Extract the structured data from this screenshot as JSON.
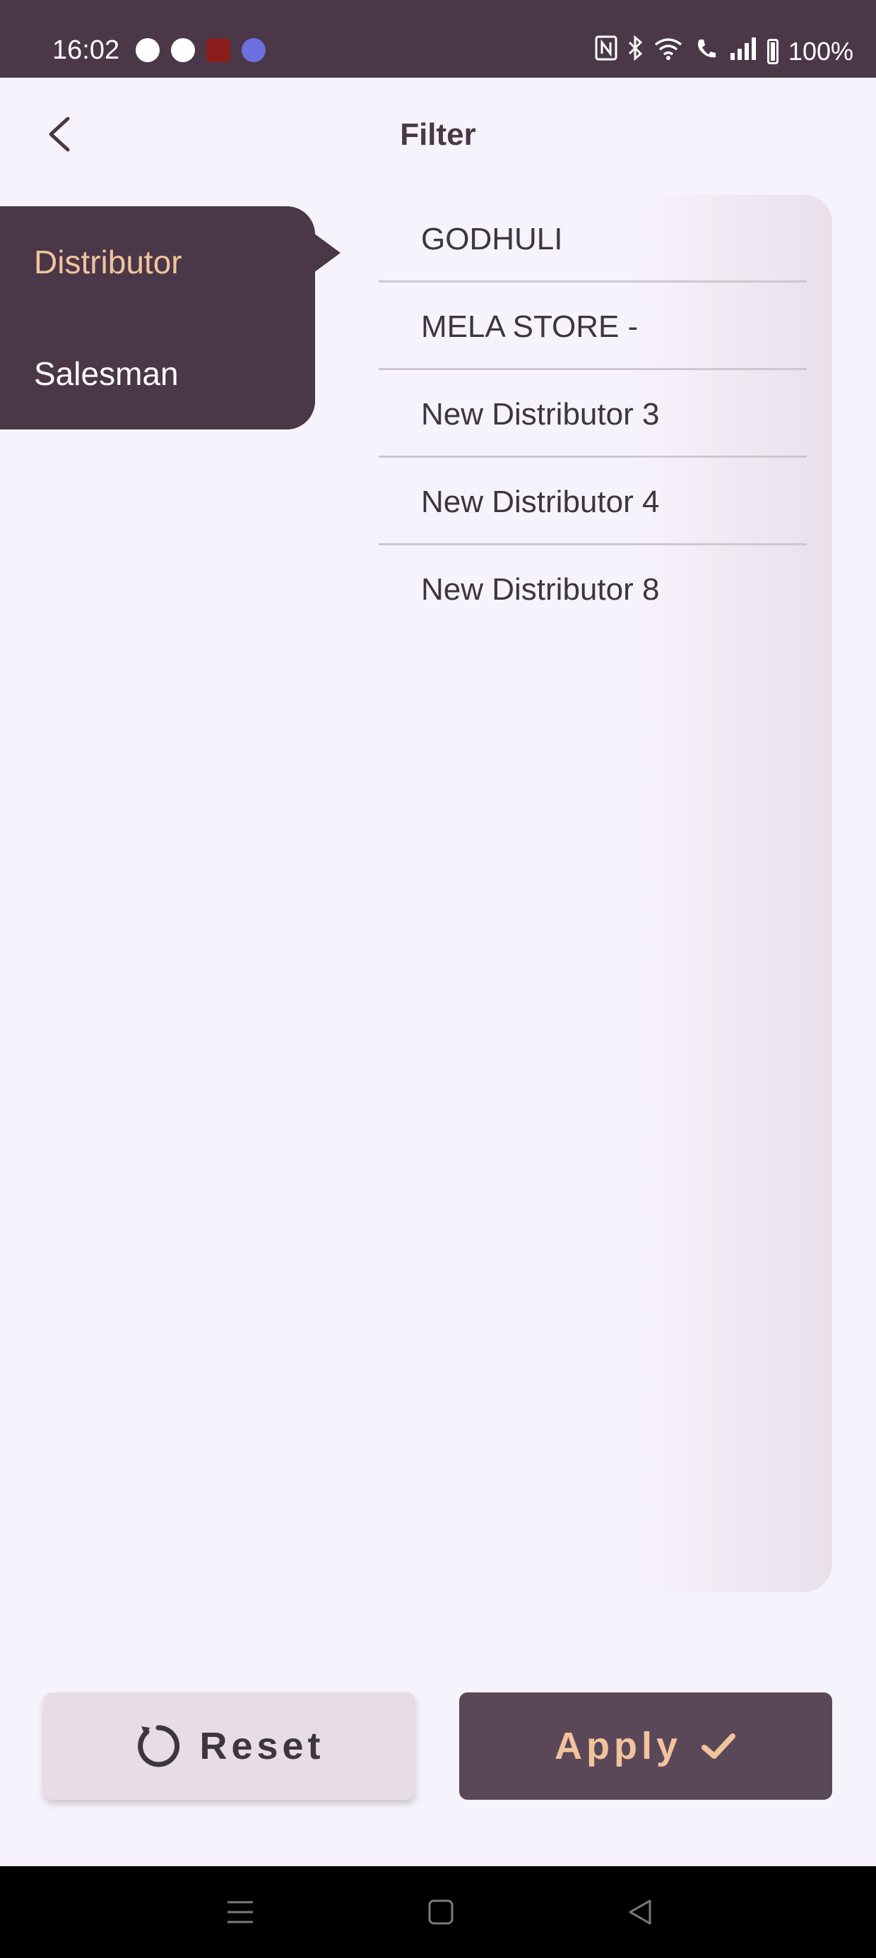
{
  "status_bar": {
    "time": "16:02",
    "battery": "100%",
    "notification_icons": [
      "chat-bubble-icon",
      "alert-circle-icon",
      "app-icon",
      "messenger-icon"
    ],
    "system_icons": [
      "nfc-icon",
      "bluetooth-icon",
      "wifi-icon",
      "wifi-call-icon",
      "signal-icon",
      "battery-icon"
    ]
  },
  "header": {
    "title": "Filter",
    "back_icon": "chevron-left-icon"
  },
  "categories": {
    "items": [
      {
        "label": "Distributor",
        "active": true
      },
      {
        "label": "Salesman",
        "active": false
      }
    ]
  },
  "options": {
    "items": [
      {
        "label": "GODHULI"
      },
      {
        "label": "MELA STORE -"
      },
      {
        "label": "New Distributor 3"
      },
      {
        "label": "New Distributor 4"
      },
      {
        "label": "New Distributor 8"
      }
    ]
  },
  "actions": {
    "reset_label": "Reset",
    "reset_icon": "refresh-icon",
    "apply_label": "Apply",
    "apply_icon": "check-icon"
  },
  "navigation": {
    "items": [
      "menu-icon",
      "home-icon",
      "back-icon"
    ]
  },
  "colors": {
    "primary": "#4a3848",
    "accent": "#f2c39d",
    "background": "#f7f3fc",
    "reset_bg": "#e8dce5",
    "apply_bg": "#5a4858"
  }
}
